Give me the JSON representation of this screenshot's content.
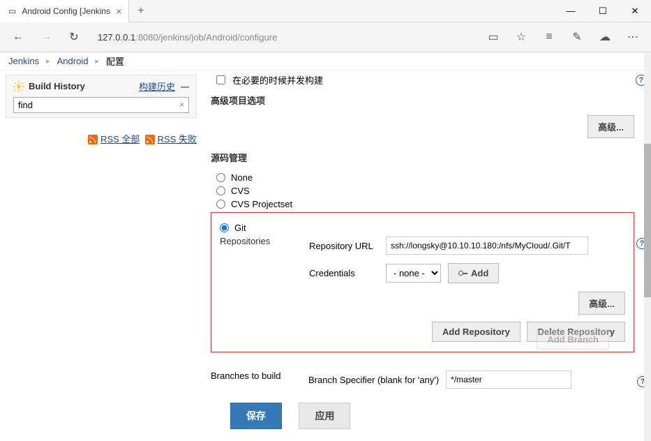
{
  "browser": {
    "tab_title": "Android Config [Jenkins",
    "url_host": "127.0.0.1",
    "url_port_path": ":8080/jenkins/job/Android/configure"
  },
  "breadcrumb": {
    "item1": "Jenkins",
    "item2": "Android",
    "item3": "配置"
  },
  "sidebar": {
    "title": "Build History",
    "history_link": "构建历史",
    "trend": "—",
    "search_value": "find",
    "rss_all": "RSS 全部",
    "rss_fail": "RSS 失败"
  },
  "main": {
    "parallel_build": "在必要的时候并发构建",
    "advanced_project": "高级项目选项",
    "advanced_btn": "高级...",
    "scm_title": "源码管理",
    "scm": {
      "none": "None",
      "cvs": "CVS",
      "cvs_ps": "CVS Projectset",
      "git": "Git"
    },
    "repos_label": "Repositories",
    "repo_url_label": "Repository URL",
    "repo_url_value": "ssh://longsky@10.10.10.180:/nfs/MyCloud/.Git/T",
    "credentials_label": "Credentials",
    "credentials_value": "- none -",
    "add_cred": "Add",
    "repo_advanced": "高级...",
    "add_repo": "Add Repository",
    "delete_repo": "Delete Repository",
    "branches_label": "Branches to build",
    "branch_spec_label": "Branch Specifier (blank for 'any')",
    "branch_spec_value": "*/master",
    "add_branch": "Add Branch",
    "save": "保存",
    "apply": "应用"
  }
}
